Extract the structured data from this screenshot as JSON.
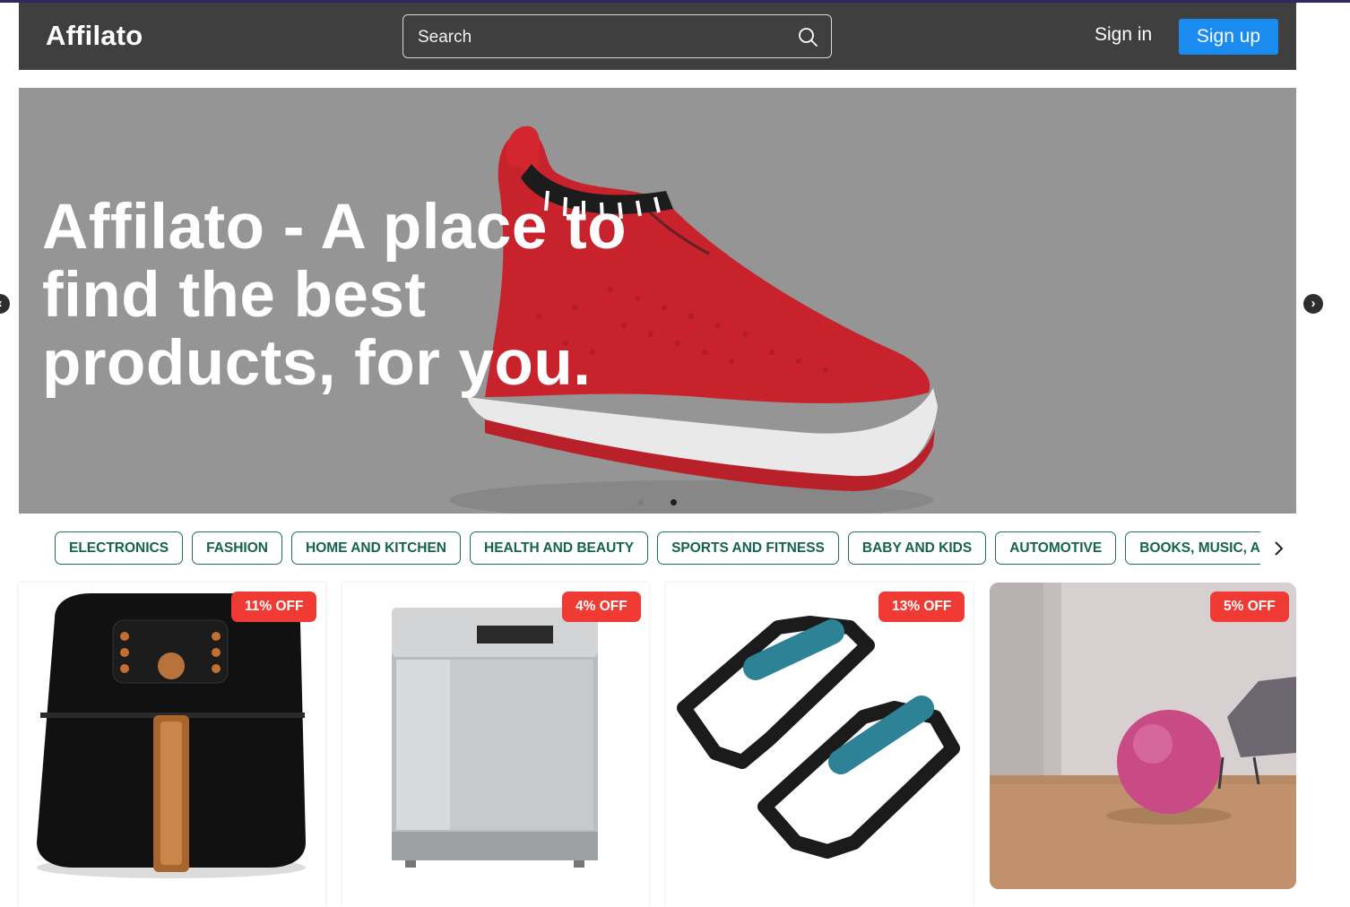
{
  "header": {
    "logo": "Affilato",
    "search_placeholder": "Search",
    "sign_in": "Sign in",
    "sign_up": "Sign up"
  },
  "hero": {
    "title": "Affilato - A place to find the best products, for you.",
    "slide_count": 2,
    "active_slide": 2,
    "prev_icon": "chevron-left-icon",
    "next_icon": "chevron-right-icon"
  },
  "categories": [
    "ELECTRONICS",
    "FASHION",
    "HOME AND KITCHEN",
    "HEALTH AND BEAUTY",
    "SPORTS AND FITNESS",
    "BABY AND KIDS",
    "AUTOMOTIVE",
    "BOOKS, MUSIC, AND MOVIES"
  ],
  "products": [
    {
      "discount": "11% OFF"
    },
    {
      "discount": "4% OFF"
    },
    {
      "discount": "13% OFF"
    },
    {
      "discount": "5% OFF"
    }
  ],
  "colors": {
    "header_bg": "#3f3f3f",
    "signup_bg": "#1a8cf0",
    "chip_border": "#1f6f5c",
    "badge_bg": "#ef3b34",
    "hero_bg": "#959595"
  }
}
